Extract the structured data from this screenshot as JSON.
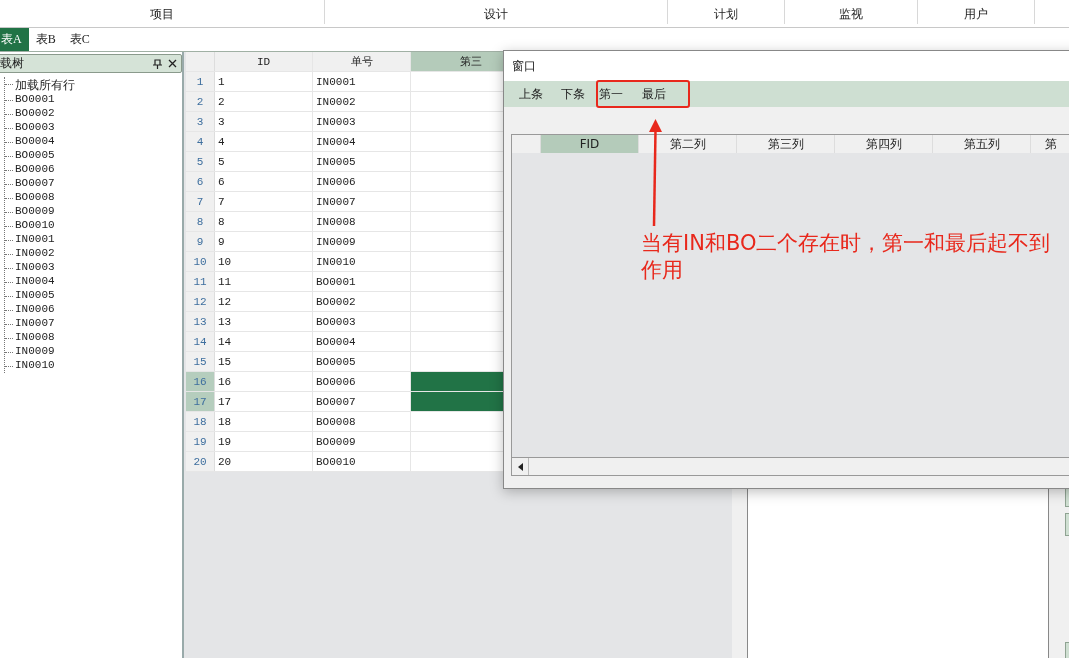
{
  "ribbon": {
    "groups": [
      "项目",
      "设计",
      "计划",
      "监视",
      "用户"
    ]
  },
  "tabs": [
    {
      "label": "表A",
      "selected": true
    },
    {
      "label": "表B",
      "selected": false
    },
    {
      "label": "表C",
      "selected": false
    }
  ],
  "tree_panel": {
    "title": "载树",
    "items": [
      "加载所有行",
      "BO0001",
      "BO0002",
      "BO0003",
      "BO0004",
      "BO0005",
      "BO0006",
      "BO0007",
      "BO0008",
      "BO0009",
      "BO0010",
      "IN0001",
      "IN0002",
      "IN0003",
      "IN0004",
      "IN0005",
      "IN0006",
      "IN0007",
      "IN0008",
      "IN0009",
      "IN0010"
    ]
  },
  "grid": {
    "columns": [
      {
        "label": "ID",
        "selected": false
      },
      {
        "label": "单号",
        "selected": false
      },
      {
        "label": "第三",
        "selected": true
      }
    ],
    "rows": [
      {
        "num": "1",
        "id": "1",
        "code": "IN0001",
        "selected": false
      },
      {
        "num": "2",
        "id": "2",
        "code": "IN0002",
        "selected": false
      },
      {
        "num": "3",
        "id": "3",
        "code": "IN0003",
        "selected": false
      },
      {
        "num": "4",
        "id": "4",
        "code": "IN0004",
        "selected": false
      },
      {
        "num": "5",
        "id": "5",
        "code": "IN0005",
        "selected": false
      },
      {
        "num": "6",
        "id": "6",
        "code": "IN0006",
        "selected": false
      },
      {
        "num": "7",
        "id": "7",
        "code": "IN0007",
        "selected": false
      },
      {
        "num": "8",
        "id": "8",
        "code": "IN0008",
        "selected": false
      },
      {
        "num": "9",
        "id": "9",
        "code": "IN0009",
        "selected": false
      },
      {
        "num": "10",
        "id": "10",
        "code": "IN0010",
        "selected": false
      },
      {
        "num": "11",
        "id": "11",
        "code": "BO0001",
        "selected": false
      },
      {
        "num": "12",
        "id": "12",
        "code": "BO0002",
        "selected": false
      },
      {
        "num": "13",
        "id": "13",
        "code": "BO0003",
        "selected": false
      },
      {
        "num": "14",
        "id": "14",
        "code": "BO0004",
        "selected": false
      },
      {
        "num": "15",
        "id": "15",
        "code": "BO0005",
        "selected": false
      },
      {
        "num": "16",
        "id": "16",
        "code": "BO0006",
        "selected": true
      },
      {
        "num": "17",
        "id": "17",
        "code": "BO0007",
        "selected": true
      },
      {
        "num": "18",
        "id": "18",
        "code": "BO0008",
        "selected": false
      },
      {
        "num": "19",
        "id": "19",
        "code": "BO0009",
        "selected": false
      },
      {
        "num": "20",
        "id": "20",
        "code": "BO0010",
        "selected": false
      }
    ]
  },
  "dialog": {
    "title": "窗口",
    "toolbar": [
      {
        "label": "上条",
        "highlighted": false
      },
      {
        "label": "下条",
        "highlighted": false
      },
      {
        "label": "第一",
        "highlighted": true
      },
      {
        "label": "最后",
        "highlighted": true
      }
    ],
    "columns": [
      {
        "label": "FID",
        "selected": true
      },
      {
        "label": "第二列",
        "selected": false
      },
      {
        "label": "第三列",
        "selected": false
      },
      {
        "label": "第四列",
        "selected": false
      },
      {
        "label": "第五列",
        "selected": false
      },
      {
        "label": "第",
        "selected": false
      }
    ]
  },
  "annotation": {
    "text": "当有IN和BO二个存在时，第一和最后起不到作用"
  }
}
